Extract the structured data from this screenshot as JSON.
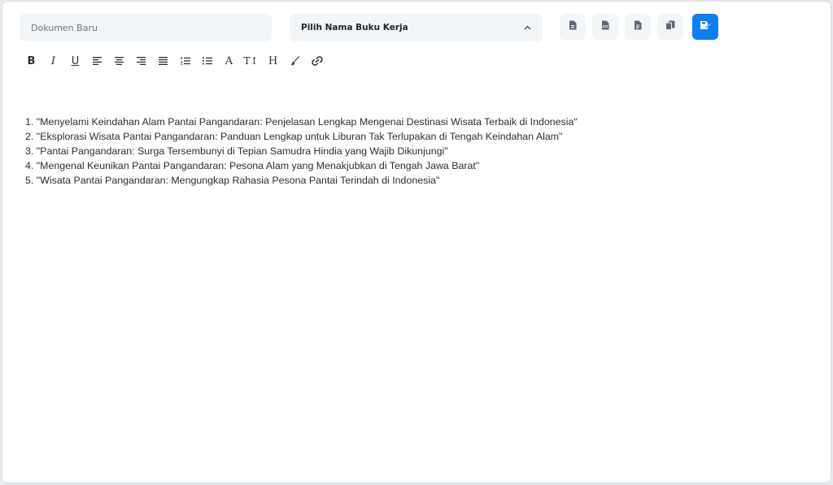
{
  "header": {
    "document_name": {
      "value": "",
      "placeholder": "Dokumen Baru"
    },
    "workbook_select": {
      "label": "Pilih Nama Buku Kerja"
    },
    "action_buttons": [
      {
        "icon": "file-icon"
      },
      {
        "icon": "pdf-icon"
      },
      {
        "icon": "doc-icon"
      },
      {
        "icon": "copy-icon"
      },
      {
        "icon": "save-icon"
      }
    ]
  },
  "toolbar": {
    "bold": "B",
    "italic": "I",
    "underline": "U",
    "font_label": "A",
    "text_size": "T↕",
    "heading": "H"
  },
  "editor": {
    "lines": [
      "1. \"Menyelami Keindahan Alam Pantai Pangandaran: Penjelasan Lengkap Mengenai Destinasi Wisata Terbaik di Indonesia\"",
      "2. \"Eksplorasi Wisata Pantai Pangandaran: Panduan Lengkap untuk Liburan Tak Terlupakan di Tengah Keindahan Alam\"",
      "3. \"Pantai Pangandaran: Surga Tersembunyi di Tepian Samudra Hindia yang Wajib Dikunjungi\"",
      "4. \"Mengenal Keunikan Pantai Pangandaran: Pesona Alam yang Menakjubkan di Tengah Jawa Barat\"",
      "5. \"Wisata Pantai Pangandaran: Mengungkap Rahasia Pesona Pantai Terindah di Indonesia\""
    ]
  },
  "colors": {
    "accent": "#0d7ff2",
    "input_bg": "#f3f6f9",
    "icon": "#6b7180"
  }
}
